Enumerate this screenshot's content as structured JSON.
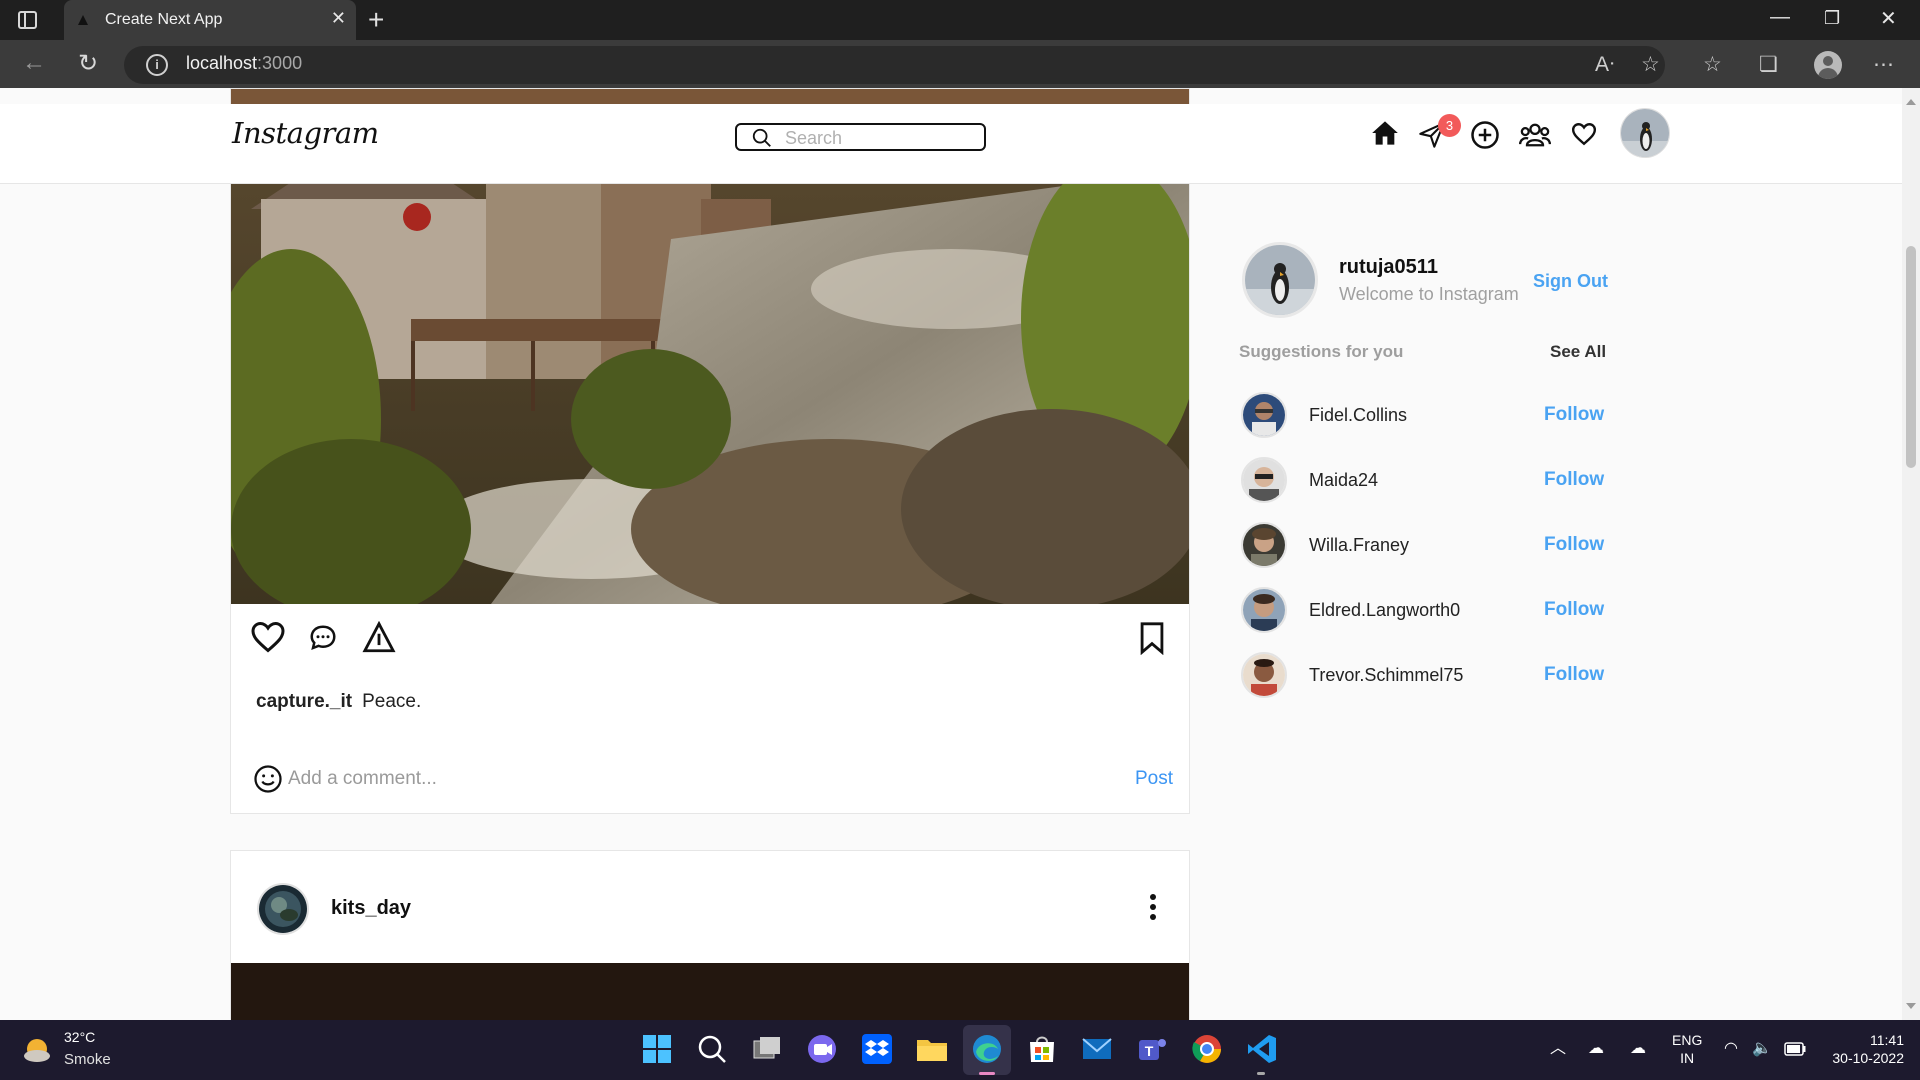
{
  "browser": {
    "tab_title": "Create Next App",
    "url_host": "localhost",
    "url_port": ":3000"
  },
  "header": {
    "logo": "Instagram",
    "search_placeholder": "Search",
    "notification_count": "3"
  },
  "post1": {
    "username": "capture._it",
    "caption": "Peace.",
    "comment_placeholder": "Add a comment...",
    "post_label": "Post"
  },
  "post2": {
    "username": "kits_day"
  },
  "profile": {
    "username": "rutuja0511",
    "subtitle": "Welcome to Instagram",
    "signout_label": "Sign Out"
  },
  "suggestions": {
    "title": "Suggestions for you",
    "see_all_label": "See All",
    "items": [
      {
        "name": "Fidel.Collins",
        "action": "Follow"
      },
      {
        "name": "Maida24",
        "action": "Follow"
      },
      {
        "name": "Willa.Franey",
        "action": "Follow"
      },
      {
        "name": "Eldred.Langworth0",
        "action": "Follow"
      },
      {
        "name": "Trevor.Schimmel75",
        "action": "Follow"
      }
    ]
  },
  "taskbar": {
    "temperature": "32°C",
    "weather": "Smoke",
    "lang_top": "ENG",
    "lang_bottom": "IN",
    "time": "11:41",
    "date": "30-10-2022"
  },
  "colors": {
    "accent_blue": "#4aa3f2",
    "badge_red": "#f25a5a"
  }
}
